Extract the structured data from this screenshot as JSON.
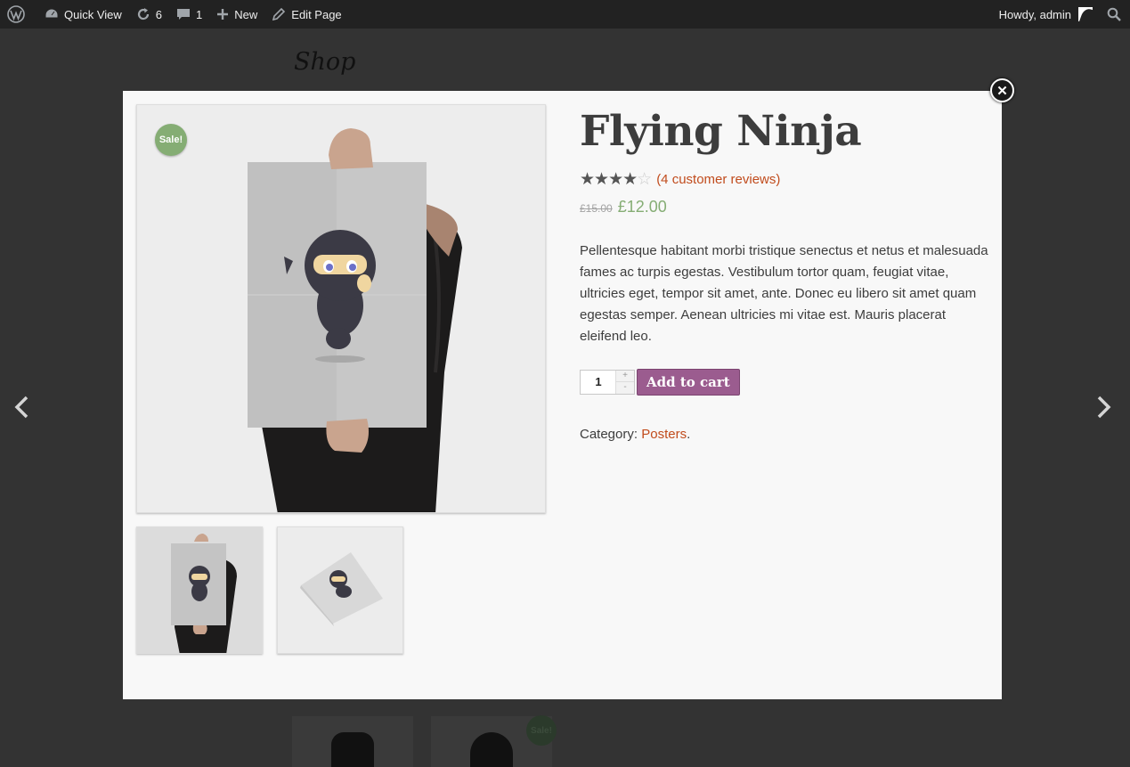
{
  "adminbar": {
    "site_label": "Quick View",
    "updates_count": "6",
    "comments_count": "1",
    "new_label": "New",
    "edit_label": "Edit Page",
    "howdy": "Howdy, admin"
  },
  "page": {
    "title": "Shop",
    "bg_sale_label": "Sale!"
  },
  "modal": {
    "close_symbol": "✕",
    "sale_label": "Sale!",
    "product": {
      "title": "Flying Ninja",
      "rating": 4,
      "rating_max": 5,
      "reviews_link": "(4 customer reviews)",
      "old_price": "£15.00",
      "price": "£12.00",
      "description": "Pellentesque habitant morbi tristique senectus et netus et malesuada fames ac turpis egestas. Vestibulum tortor quam, feugiat vitae, ultricies eget, tempor sit amet, ante. Donec eu libero sit amet quam egestas semper. Aenean ultricies mi vitae est. Mauris placerat eleifend leo.",
      "quantity": "1",
      "qty_plus": "+",
      "qty_minus": "-",
      "add_to_cart": "Add to cart",
      "category_label": "Category:",
      "category": "Posters",
      "category_end": "."
    }
  },
  "colors": {
    "accent": "#9b5c8f",
    "link": "#c14c1d",
    "sale": "#85ad74"
  },
  "icons": [
    "wordpress-icon",
    "dashboard-icon",
    "updates-icon",
    "comment-icon",
    "plus-icon",
    "pencil-icon",
    "search-icon",
    "chevron-left-icon",
    "chevron-right-icon",
    "close-icon"
  ]
}
